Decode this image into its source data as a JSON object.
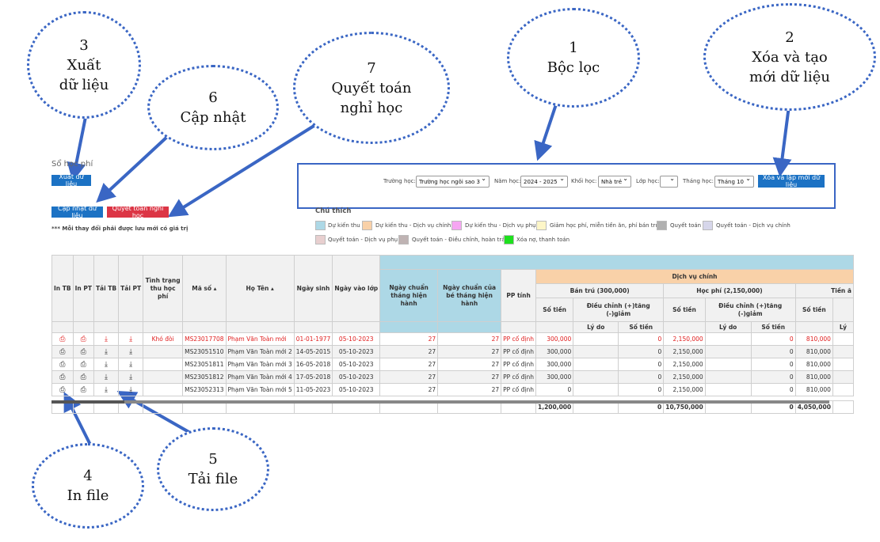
{
  "callouts": [
    {
      "num": "3",
      "lines": [
        "Xuất",
        "dữ liệu"
      ]
    },
    {
      "num": "6",
      "lines": [
        "Cập nhật"
      ]
    },
    {
      "num": "7",
      "lines": [
        "Quyết toán",
        "nghỉ học"
      ]
    },
    {
      "num": "1",
      "lines": [
        "Bộc lọc"
      ]
    },
    {
      "num": "2",
      "lines": [
        "Xóa và tạo",
        "mới dữ liệu"
      ]
    },
    {
      "num": "4",
      "lines": [
        "In file"
      ]
    },
    {
      "num": "5",
      "lines": [
        "Tải file"
      ]
    }
  ],
  "page": {
    "title": "Sổ học phí",
    "export_label": "Xuất dữ liệu",
    "update_label": "Cập nhật dữ liệu",
    "settle_label": "Quyết toán nghỉ học",
    "note": "*** Mỗi thay đổi phải được lưu mới có giá trị"
  },
  "filters": {
    "school_label": "Trường học:",
    "school_value": "Trường học ngôi sao 3",
    "year_label": "Năm học:",
    "year_value": "2024 - 2025",
    "block_label": "Khối học:",
    "block_value": "Nhà trẻ",
    "class_label": "Lớp học:",
    "class_value": "",
    "month_label": "Tháng học:",
    "month_value": "Tháng 10",
    "reset_label": "Xóa và lập mới dữ liệu"
  },
  "legend": {
    "title": "Chú thích",
    "items": [
      {
        "label": "Dự kiến thu",
        "color": "#add8e6"
      },
      {
        "label": "Dự kiến thu - Dịch vụ chính",
        "color": "#f9d1a8"
      },
      {
        "label": "Dự kiến thu - Dịch vụ phụ",
        "color": "#f6a6f2"
      },
      {
        "label": "Giảm học phí, miễn tiền ăn, phí bán trú",
        "color": "#fdf6c8"
      },
      {
        "label": "Quyết toán",
        "color": "#b0b0b0"
      },
      {
        "label": "Quyết toán - Dịch vụ chính",
        "color": "#d6d6ea"
      },
      {
        "label": "Quyết toán - Dịch vụ phụ",
        "color": "#e8cfcf"
      },
      {
        "label": "Quyết toán - Điều chỉnh, hoàn trả",
        "color": "#bfb3b3"
      },
      {
        "label": "Xóa nợ, thanh toán",
        "color": "#1ee01e"
      }
    ]
  },
  "table": {
    "headers": {
      "in_tb": "In TB",
      "in_pt": "In PT",
      "tai_tb": "Tải TB",
      "tai_pt": "Tải PT",
      "status": "Tình trạng thu học phí",
      "code": "Mã số",
      "name": "Họ Tên",
      "dob": "Ngày sinh",
      "enroll": "Ngày vào lớp",
      "std_month": "Ngày chuẩn tháng hiện hành",
      "child_month": "Ngày chuẩn của bé tháng hiện hành",
      "method": "PP tính",
      "main_service": "Dịch vụ chính",
      "boarding": "Bán trú (300,000)",
      "tuition": "Học phí (2,150,000)",
      "meal": "Tiền ă",
      "amount": "Số tiền",
      "adjust": "Điều chỉnh (+)tăng (-)giảm",
      "reason": "Lý do",
      "adj_amount": "Số tiền",
      "reason_cut": "Lý"
    },
    "rows": [
      {
        "status": "Khó đòi",
        "code": "MS23017708",
        "name": "Phạm Văn Toàn mới",
        "dob": "01-01-1977",
        "enroll": "05-10-2023",
        "std": "27",
        "child": "27",
        "method": "PP cố định",
        "b_amt": "300,000",
        "b_adj": "0",
        "t_amt": "2,150,000",
        "t_adj": "0",
        "m_amt": "810,000"
      },
      {
        "status": "",
        "code": "MS23051510",
        "name": "Phạm Văn Toàn mới 2",
        "dob": "14-05-2015",
        "enroll": "05-10-2023",
        "std": "27",
        "child": "27",
        "method": "PP cố định",
        "b_amt": "300,000",
        "b_adj": "0",
        "t_amt": "2,150,000",
        "t_adj": "0",
        "m_amt": "810,000"
      },
      {
        "status": "",
        "code": "MS23051811",
        "name": "Phạm Văn Toàn mới 3",
        "dob": "16-05-2018",
        "enroll": "05-10-2023",
        "std": "27",
        "child": "27",
        "method": "PP cố định",
        "b_amt": "300,000",
        "b_adj": "0",
        "t_amt": "2,150,000",
        "t_adj": "0",
        "m_amt": "810,000"
      },
      {
        "status": "",
        "code": "MS23051812",
        "name": "Phạm Văn Toàn mới 4",
        "dob": "17-05-2018",
        "enroll": "05-10-2023",
        "std": "27",
        "child": "27",
        "method": "PP cố định",
        "b_amt": "300,000",
        "b_adj": "0",
        "t_amt": "2,150,000",
        "t_adj": "0",
        "m_amt": "810,000"
      },
      {
        "status": "",
        "code": "MS23052313",
        "name": "Phạm Văn Toàn mới 5",
        "dob": "11-05-2023",
        "enroll": "05-10-2023",
        "std": "27",
        "child": "27",
        "method": "PP cố định",
        "b_amt": "0",
        "b_adj": "0",
        "t_amt": "2,150,000",
        "t_adj": "0",
        "m_amt": "810,000"
      }
    ],
    "totals": {
      "b_amt": "1,200,000",
      "b_adj": "0",
      "t_amt": "10,750,000",
      "t_adj": "0",
      "m_amt": "4,050,000"
    }
  }
}
